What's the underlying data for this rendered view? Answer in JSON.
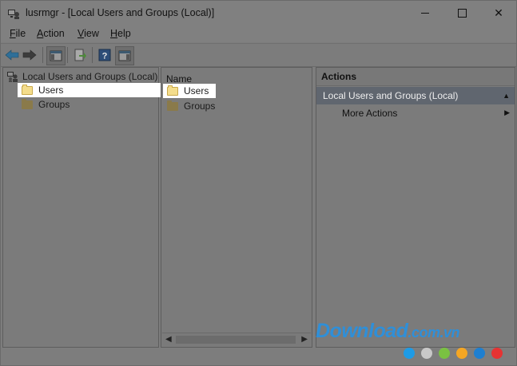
{
  "window": {
    "title": "lusrmgr - [Local Users and Groups (Local)]"
  },
  "menu": [
    {
      "mnemonic": "F",
      "rest": "ile"
    },
    {
      "mnemonic": "A",
      "rest": "ction"
    },
    {
      "mnemonic": "V",
      "rest": "iew"
    },
    {
      "mnemonic": "H",
      "rest": "elp"
    }
  ],
  "toolbar": {
    "icons": [
      "back-arrow-icon",
      "forward-arrow-icon",
      "show-hide-console-tree-icon",
      "export-list-icon",
      "help-icon",
      "show-hide-action-pane-icon"
    ]
  },
  "tree": {
    "root": "Local Users and Groups (Local)",
    "children": [
      "Users",
      "Groups"
    ],
    "selected": "Users"
  },
  "list": {
    "column_header": "Name",
    "items": [
      "Users",
      "Groups"
    ]
  },
  "actions": {
    "header": "Actions",
    "group": "Local Users and Groups (Local)",
    "more": "More Actions"
  },
  "watermark": {
    "brand": "Download",
    "suffix": ".com.vn",
    "dot_colors": [
      "#1e9be6",
      "#c8c8c8",
      "#7ac142",
      "#f5a623",
      "#1e7fd0",
      "#e63333"
    ]
  }
}
